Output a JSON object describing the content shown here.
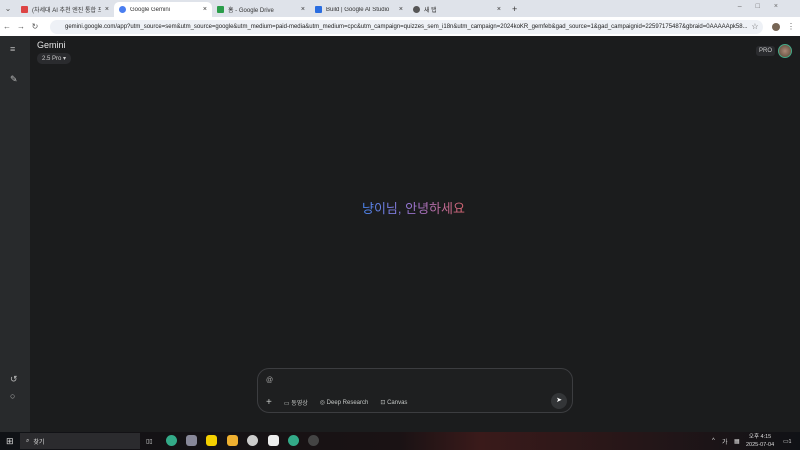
{
  "browser": {
    "tabs": [
      {
        "title": "(차세대 AI 추천 엔진 통합 프로",
        "icon": "gmail-icon",
        "color": "#d44"
      },
      {
        "title": "Google Gemini",
        "icon": "gemini-icon",
        "color": "#4a7ef0",
        "active": true
      },
      {
        "title": "홈 - Google Drive",
        "icon": "drive-icon",
        "color": "#2a9d4a"
      },
      {
        "title": "Build | Google AI Studio",
        "icon": "ai-studio-icon",
        "color": "#2a6de0"
      },
      {
        "title": "새 탭",
        "icon": "chrome-icon",
        "color": "#555"
      }
    ],
    "new_tab": "+",
    "close": "×",
    "url": "gemini.google.com/app?utm_source=sem&utm_source=google&utm_medium=paid-media&utm_medium=cpc&utm_campaign=quizzes_sem_i18n&utm_campaign=2024koKR_gemfeb&gad_source=1&gad_campaignid=22597175487&gbraid=0AAAAApk58..."
  },
  "app": {
    "title": "Gemini",
    "model": "2.5 Pro ▾",
    "pro_badge": "PRO",
    "greeting": "냥이님, 안녕하세요",
    "input": {
      "value": "@"
    },
    "tools": [
      {
        "label": "동영상",
        "icon": "video-icon"
      },
      {
        "label": "Deep Research",
        "icon": "deep-research-icon"
      },
      {
        "label": "Canvas",
        "icon": "canvas-icon"
      }
    ]
  },
  "taskbar": {
    "search_placeholder": "찾기",
    "time": "오후 4:15",
    "date": "2025-07-04",
    "ime": "가",
    "notifications": "1"
  }
}
